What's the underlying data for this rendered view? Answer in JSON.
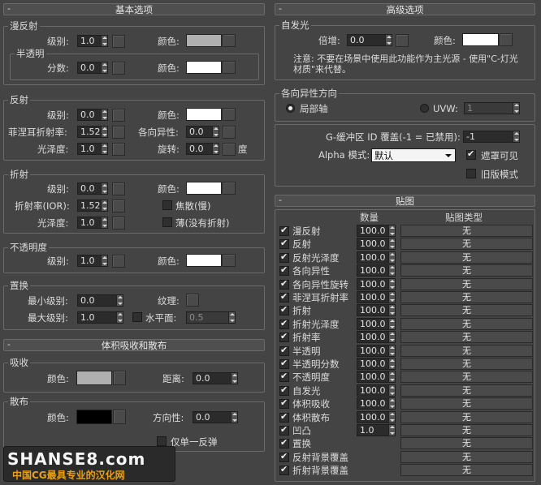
{
  "left": {
    "basic": {
      "title": "基本选项",
      "diffuse": {
        "label": "漫反射",
        "level_label": "级别:",
        "level": "1.0",
        "color_label": "颜色:",
        "color": "#b0b0b0"
      },
      "translucency": {
        "label": "半透明",
        "fraction_label": "分数:",
        "fraction": "0.0",
        "color_label": "颜色:",
        "color": "#ffffff"
      },
      "reflection": {
        "label": "反射",
        "level_label": "级别:",
        "level": "0.0",
        "color_label": "颜色:",
        "color": "#ffffff",
        "fresnel_label": "菲涅耳折射率:",
        "fresnel": "1.52",
        "aniso_label": "各向异性:",
        "aniso": "0.0",
        "gloss_label": "光泽度:",
        "gloss": "1.0",
        "rotation_label": "旋转:",
        "rotation": "0.0",
        "degree_label": "度"
      },
      "refraction": {
        "label": "折射",
        "level_label": "级别:",
        "level": "0.0",
        "color_label": "颜色:",
        "color": "#ffffff",
        "ior_label": "折射率(IOR):",
        "ior": "1.52",
        "caustics_label": "焦散(慢)",
        "gloss_label": "光泽度:",
        "gloss": "1.0",
        "thin_label": "薄(没有折射)"
      },
      "opacity": {
        "label": "不透明度",
        "level_label": "级别:",
        "level": "1.0",
        "color_label": "颜色:",
        "color": "#ffffff"
      },
      "displacement": {
        "label": "置换",
        "min_label": "最小级别:",
        "min": "0.0",
        "texture_label": "纹理:",
        "max_label": "最大级别:",
        "max": "1.0",
        "water_label": "水平面:",
        "water": "0.5"
      }
    },
    "volume": {
      "title": "体积吸收和散布",
      "absorption": {
        "label": "吸收",
        "color_label": "颜色:",
        "color": "#b0b0b0",
        "distance_label": "距离:",
        "distance": "0.0"
      },
      "scatter": {
        "label": "散布",
        "color_label": "颜色:",
        "color": "#000000",
        "direction_label": "方向性:",
        "direction": "0.0",
        "single_bounce_label": "仅单一反弹"
      }
    }
  },
  "right": {
    "advanced": {
      "title": "高级选项",
      "emission": {
        "label": "自发光",
        "multiplier_label": "倍增:",
        "multiplier": "0.0",
        "color_label": "颜色:",
        "color": "#ffffff",
        "note": "注意: 不要在场景中使用此功能作为主光源 - 使用\"C-灯光材质\"来代替。"
      },
      "aniso_dir": {
        "label": "各向异性方向",
        "local_axis_label": "局部轴",
        "uvw_label": "UVW:",
        "uvw": "1"
      },
      "gbuffer_label": "G-缓冲区 ID 覆盖(-1 = 已禁用):",
      "gbuffer": "-1",
      "alpha_label": "Alpha 模式:",
      "alpha_mode": "默认",
      "mask_visible_label": "遮罩可见",
      "legacy_label": "旧版模式"
    },
    "maps": {
      "title": "贴图",
      "col_amount": "数量",
      "col_type": "贴图类型",
      "rows": [
        {
          "name": "漫反射",
          "amount": "100.0",
          "map": "无"
        },
        {
          "name": "反射",
          "amount": "100.0",
          "map": "无"
        },
        {
          "name": "反射光泽度",
          "amount": "100.0",
          "map": "无"
        },
        {
          "name": "各向异性",
          "amount": "100.0",
          "map": "无"
        },
        {
          "name": "各向异性旋转",
          "amount": "100.0",
          "map": "无"
        },
        {
          "name": "菲涅耳折射率",
          "amount": "100.0",
          "map": "无"
        },
        {
          "name": "折射",
          "amount": "100.0",
          "map": "无"
        },
        {
          "name": "折射光泽度",
          "amount": "100.0",
          "map": "无"
        },
        {
          "name": "折射率",
          "amount": "100.0",
          "map": "无"
        },
        {
          "name": "半透明",
          "amount": "100.0",
          "map": "无"
        },
        {
          "name": "半透明分数",
          "amount": "100.0",
          "map": "无"
        },
        {
          "name": "不透明度",
          "amount": "100.0",
          "map": "无"
        },
        {
          "name": "自发光",
          "amount": "100.0",
          "map": "无"
        },
        {
          "name": "体积吸收",
          "amount": "100.0",
          "map": "无"
        },
        {
          "name": "体积散布",
          "amount": "100.0",
          "map": "无"
        },
        {
          "name": "凹凸",
          "amount": "1.0",
          "map": "无"
        },
        {
          "name": "置换",
          "amount": "",
          "map": "无"
        },
        {
          "name": "反射背景覆盖",
          "amount": "",
          "map": "无"
        },
        {
          "name": "折射背景覆盖",
          "amount": "",
          "map": "无"
        }
      ]
    }
  },
  "watermark": {
    "logo": "SHANSE8.com",
    "slogan": "中国CG最具专业的汉化网"
  }
}
